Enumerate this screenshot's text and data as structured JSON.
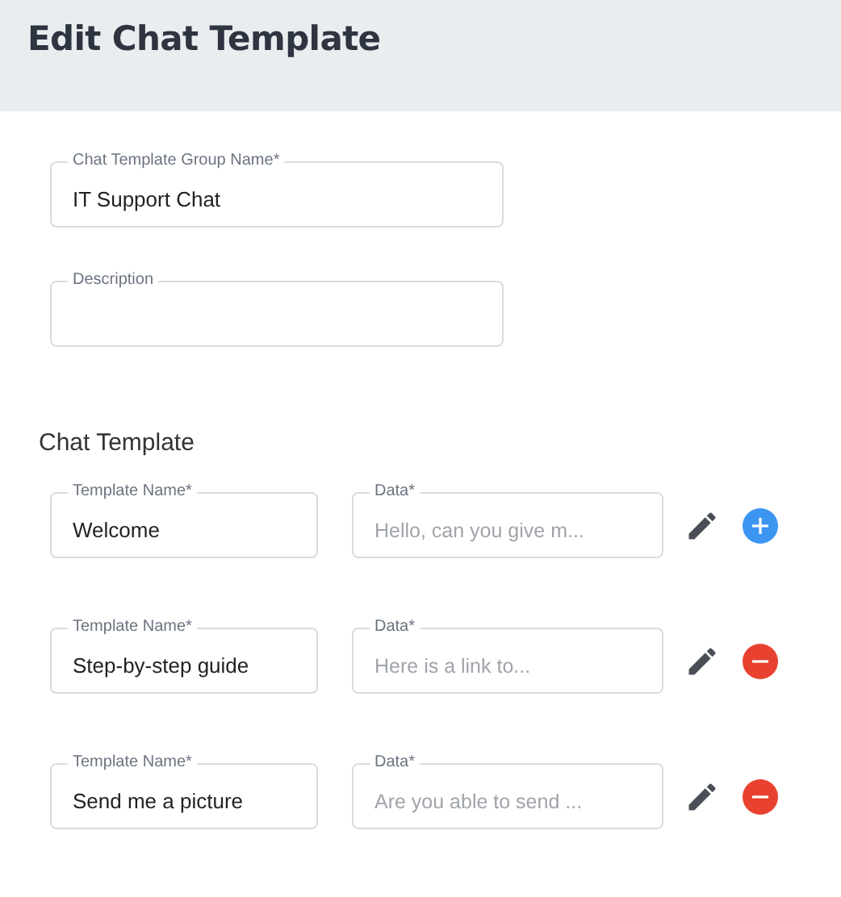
{
  "header": {
    "title": "Edit Chat Template"
  },
  "group_name": {
    "label": "Chat Template Group Name*",
    "value": "IT Support Chat"
  },
  "description": {
    "label": "Description"
  },
  "section_title": "Chat Template",
  "templates": [
    {
      "name_label": "Template Name*",
      "name": "Welcome",
      "data_label": "Data*",
      "data_placeholder": "Hello, can you give m...",
      "kind": "add"
    },
    {
      "name_label": "Template Name*",
      "name": "Step-by-step guide",
      "data_label": "Data*",
      "data_placeholder": "Here is a link to...",
      "kind": "remove"
    },
    {
      "name_label": "Template Name*",
      "name": "Send me a picture",
      "data_label": "Data*",
      "data_placeholder": "Are you able to send ...",
      "kind": "remove"
    }
  ]
}
